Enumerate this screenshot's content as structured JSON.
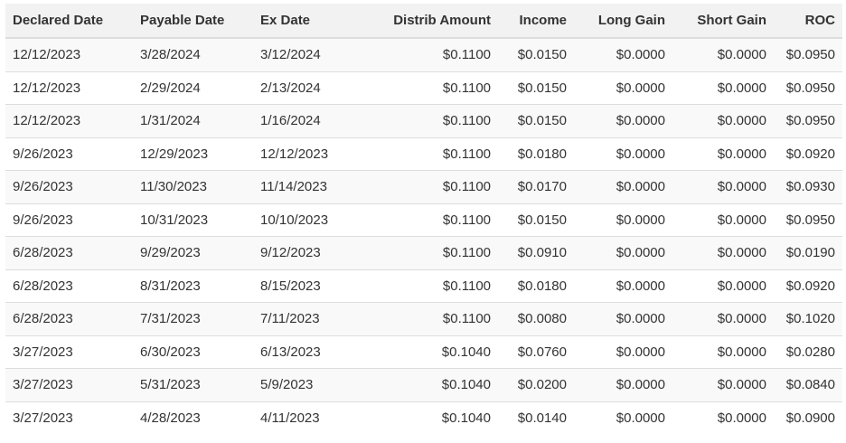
{
  "table": {
    "headers": {
      "declared": "Declared Date",
      "payable": "Payable Date",
      "ex": "Ex Date",
      "amount": "Distrib Amount",
      "income": "Income",
      "long_gain": "Long Gain",
      "short_gain": "Short Gain",
      "roc": "ROC"
    },
    "rows": [
      {
        "declared": "12/12/2023",
        "payable": "3/28/2024",
        "ex": "3/12/2024",
        "amount": "$0.1100",
        "income": "$0.0150",
        "long_gain": "$0.0000",
        "short_gain": "$0.0000",
        "roc": "$0.0950"
      },
      {
        "declared": "12/12/2023",
        "payable": "2/29/2024",
        "ex": "2/13/2024",
        "amount": "$0.1100",
        "income": "$0.0150",
        "long_gain": "$0.0000",
        "short_gain": "$0.0000",
        "roc": "$0.0950"
      },
      {
        "declared": "12/12/2023",
        "payable": "1/31/2024",
        "ex": "1/16/2024",
        "amount": "$0.1100",
        "income": "$0.0150",
        "long_gain": "$0.0000",
        "short_gain": "$0.0000",
        "roc": "$0.0950"
      },
      {
        "declared": "9/26/2023",
        "payable": "12/29/2023",
        "ex": "12/12/2023",
        "amount": "$0.1100",
        "income": "$0.0180",
        "long_gain": "$0.0000",
        "short_gain": "$0.0000",
        "roc": "$0.0920"
      },
      {
        "declared": "9/26/2023",
        "payable": "11/30/2023",
        "ex": "11/14/2023",
        "amount": "$0.1100",
        "income": "$0.0170",
        "long_gain": "$0.0000",
        "short_gain": "$0.0000",
        "roc": "$0.0930"
      },
      {
        "declared": "9/26/2023",
        "payable": "10/31/2023",
        "ex": "10/10/2023",
        "amount": "$0.1100",
        "income": "$0.0150",
        "long_gain": "$0.0000",
        "short_gain": "$0.0000",
        "roc": "$0.0950"
      },
      {
        "declared": "6/28/2023",
        "payable": "9/29/2023",
        "ex": "9/12/2023",
        "amount": "$0.1100",
        "income": "$0.0910",
        "long_gain": "$0.0000",
        "short_gain": "$0.0000",
        "roc": "$0.0190"
      },
      {
        "declared": "6/28/2023",
        "payable": "8/31/2023",
        "ex": "8/15/2023",
        "amount": "$0.1100",
        "income": "$0.0180",
        "long_gain": "$0.0000",
        "short_gain": "$0.0000",
        "roc": "$0.0920"
      },
      {
        "declared": "6/28/2023",
        "payable": "7/31/2023",
        "ex": "7/11/2023",
        "amount": "$0.1100",
        "income": "$0.0080",
        "long_gain": "$0.0000",
        "short_gain": "$0.0000",
        "roc": "$0.1020"
      },
      {
        "declared": "3/27/2023",
        "payable": "6/30/2023",
        "ex": "6/13/2023",
        "amount": "$0.1040",
        "income": "$0.0760",
        "long_gain": "$0.0000",
        "short_gain": "$0.0000",
        "roc": "$0.0280"
      },
      {
        "declared": "3/27/2023",
        "payable": "5/31/2023",
        "ex": "5/9/2023",
        "amount": "$0.1040",
        "income": "$0.0200",
        "long_gain": "$0.0000",
        "short_gain": "$0.0000",
        "roc": "$0.0840"
      },
      {
        "declared": "3/27/2023",
        "payable": "4/28/2023",
        "ex": "4/11/2023",
        "amount": "$0.1040",
        "income": "$0.0140",
        "long_gain": "$0.0000",
        "short_gain": "$0.0000",
        "roc": "$0.0900"
      }
    ]
  }
}
